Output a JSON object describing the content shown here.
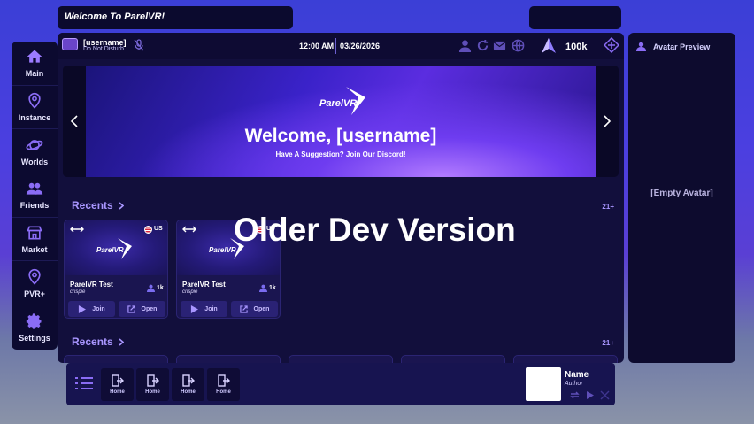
{
  "welcome_bar": {
    "text": "Welcome To ParelVR!"
  },
  "nav": {
    "items": [
      {
        "label": "Main",
        "icon": "home-icon"
      },
      {
        "label": "Instance",
        "icon": "location-pin-icon"
      },
      {
        "label": "Worlds",
        "icon": "planet-icon"
      },
      {
        "label": "Friends",
        "icon": "friends-icon"
      },
      {
        "label": "Market",
        "icon": "store-icon"
      },
      {
        "label": "PVR+",
        "icon": "location-pin-icon"
      },
      {
        "label": "Settings",
        "icon": "gear-icon"
      }
    ]
  },
  "status_bar": {
    "username": "[username]",
    "status": "Do Not Disturb",
    "time": "12:00 AM",
    "date": "03/26/2026",
    "currency": "100k"
  },
  "banner": {
    "logo_text": "ParelVR",
    "title": "Welcome, [username]",
    "subtitle": "Have A Suggestion? Join Our Discord!"
  },
  "recents_1": {
    "label": "Recents",
    "count": "21+"
  },
  "recents_2": {
    "label": "Recents",
    "count": "21+"
  },
  "cards": [
    {
      "title": "ParelVR Test",
      "author": "crispie",
      "region": "US",
      "players": "1k",
      "logo_text": "ParelVR",
      "join_label": "Join",
      "open_label": "Open"
    },
    {
      "title": "ParelVR Test",
      "author": "crispie",
      "region": "US",
      "players": "1k",
      "logo_text": "ParelVR",
      "join_label": "Join",
      "open_label": "Open"
    }
  ],
  "overlay": {
    "text": "Older Dev Version"
  },
  "avatar_panel": {
    "title": "Avatar Preview",
    "empty_text": "[Empty Avatar]"
  },
  "dock": {
    "slots": [
      {
        "label": "Home"
      },
      {
        "label": "Home"
      },
      {
        "label": "Home"
      },
      {
        "label": "Home"
      }
    ],
    "now_playing": {
      "name": "Name",
      "author": "Author"
    }
  },
  "colors": {
    "accent": "#9b7bff",
    "panel": "#120f3c",
    "dark_panel": "#0d0b2e"
  }
}
